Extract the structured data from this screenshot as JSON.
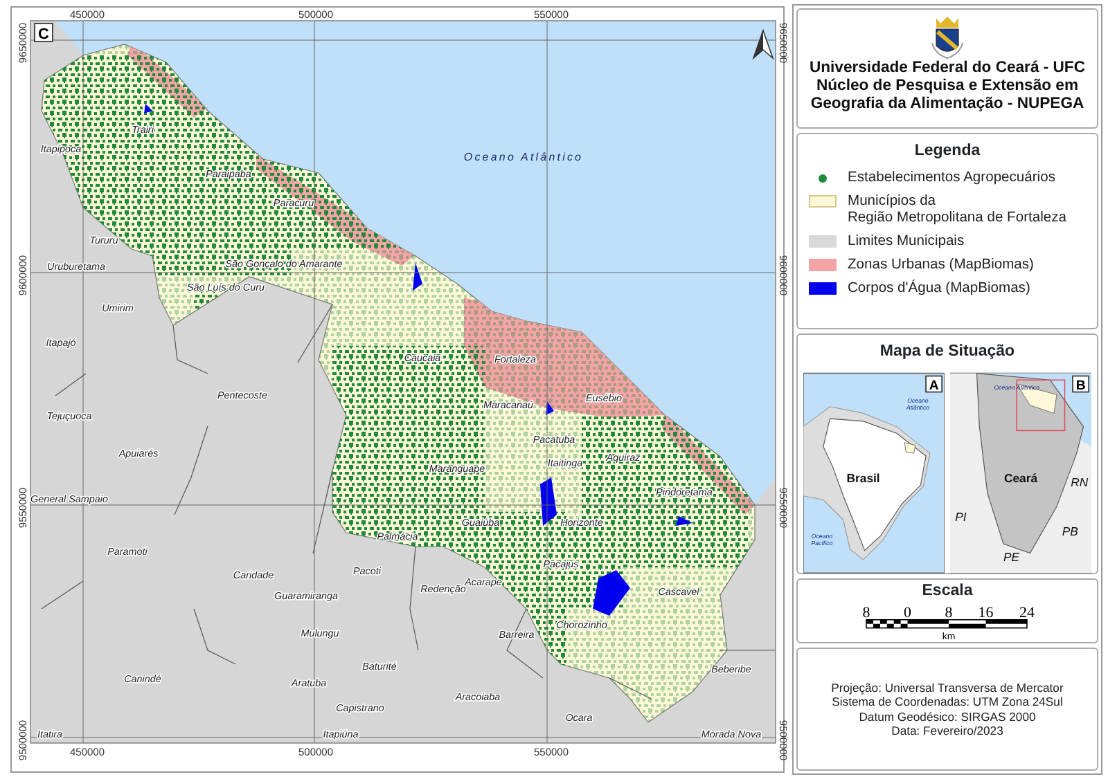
{
  "map": {
    "panel_letter": "C",
    "top_ticks": [
      "450000",
      "500000",
      "550000"
    ],
    "bottom_ticks": [
      "450000",
      "500000",
      "550000"
    ],
    "left_ticks": [
      "9650000",
      "9600000",
      "9550000",
      "9500000"
    ],
    "right_ticks": [
      "9650000",
      "9600000",
      "9550000",
      "9500000"
    ],
    "labels": [
      {
        "kind": "municipality",
        "text": "Trairi"
      },
      {
        "kind": "municipality",
        "text": "Itapipoca"
      },
      {
        "kind": "ocean",
        "text": "Oceano Atlântico"
      },
      {
        "kind": "municipality",
        "text": "Paraipaba"
      },
      {
        "kind": "municipality",
        "text": "Paracuru"
      },
      {
        "kind": "municipality",
        "text": "Tururu"
      },
      {
        "kind": "municipality",
        "text": "Uruburetama"
      },
      {
        "kind": "municipality",
        "text": "São Gonçalo do Amarante"
      },
      {
        "kind": "municipality",
        "text": "São Luís do Curu"
      },
      {
        "kind": "municipality",
        "text": "Umirim"
      },
      {
        "kind": "municipality",
        "text": "Itapajó"
      },
      {
        "kind": "municipality",
        "text": "Caucaia"
      },
      {
        "kind": "municipality",
        "text": "Fortaleza"
      },
      {
        "kind": "municipality",
        "text": "Pentecoste"
      },
      {
        "kind": "municipality",
        "text": "Maracanaú"
      },
      {
        "kind": "municipality",
        "text": "Eusébio"
      },
      {
        "kind": "municipality",
        "text": "Tejuçuoca"
      },
      {
        "kind": "municipality",
        "text": "Pacatuba"
      },
      {
        "kind": "municipality",
        "text": "Apuiarés"
      },
      {
        "kind": "municipality",
        "text": "Maranguape"
      },
      {
        "kind": "municipality",
        "text": "Itaitinga"
      },
      {
        "kind": "municipality",
        "text": "Aquiraz"
      },
      {
        "kind": "municipality",
        "text": "General Sampaio"
      },
      {
        "kind": "municipality",
        "text": "Pindoretama"
      },
      {
        "kind": "municipality",
        "text": "Guaiúba"
      },
      {
        "kind": "municipality",
        "text": "Horizonte"
      },
      {
        "kind": "municipality",
        "text": "Palmácia"
      },
      {
        "kind": "municipality",
        "text": "Paramoti"
      },
      {
        "kind": "municipality",
        "text": "Caridade"
      },
      {
        "kind": "municipality",
        "text": "Pacoti"
      },
      {
        "kind": "municipality",
        "text": "Pacajus"
      },
      {
        "kind": "municipality",
        "text": "Guaramiranga"
      },
      {
        "kind": "municipality",
        "text": "Redenção"
      },
      {
        "kind": "municipality",
        "text": "Acarape"
      },
      {
        "kind": "municipality",
        "text": "Cascavel"
      },
      {
        "kind": "municipality",
        "text": "Mulungu"
      },
      {
        "kind": "municipality",
        "text": "Barreira"
      },
      {
        "kind": "municipality",
        "text": "Chorozinho"
      },
      {
        "kind": "municipality",
        "text": "Baturité"
      },
      {
        "kind": "municipality",
        "text": "Beberibe"
      },
      {
        "kind": "municipality",
        "text": "Canindé"
      },
      {
        "kind": "municipality",
        "text": "Aratuba"
      },
      {
        "kind": "municipality",
        "text": "Aracoiaba"
      },
      {
        "kind": "municipality",
        "text": "Capistrano"
      },
      {
        "kind": "municipality",
        "text": "Ocara"
      },
      {
        "kind": "municipality",
        "text": "Itatira"
      },
      {
        "kind": "municipality",
        "text": "Itapiúna"
      },
      {
        "kind": "municipality",
        "text": "Morada Nova"
      }
    ]
  },
  "header": {
    "lines": [
      "Universidade Federal do Ceará - UFC",
      "Núcleo de Pesquisa e Extensão em",
      "Geografia da Alimentação - NUPEGA"
    ]
  },
  "legend": {
    "title": "Legenda",
    "items": [
      {
        "kind": "dot",
        "label": "Estabelecimentos Agropecuários",
        "color": "#1e8a3a"
      },
      {
        "kind": "fill",
        "label": "Municípios da\nRegião Metropolitana de Fortaleza",
        "color": "#fdf9d8"
      },
      {
        "kind": "fill",
        "label": "Limites Municipais",
        "color": "#d9d9d9"
      },
      {
        "kind": "fill",
        "label": "Zonas Urbanas (MapBiomas)",
        "color": "#f4a3a6"
      },
      {
        "kind": "fill",
        "label": "Corpos d'Água (MapBiomas)",
        "color": "#0000ee"
      }
    ]
  },
  "situation": {
    "title": "Mapa de Situação",
    "insets": [
      {
        "kind": "brazil",
        "letter": "A",
        "labels": [
          {
            "kind": "ocean",
            "text": "Oceano\nAtlântico"
          },
          {
            "kind": "country",
            "text": "Brasil"
          },
          {
            "kind": "ocean",
            "text": "Oceano\nPacífico"
          }
        ]
      },
      {
        "kind": "state",
        "letter": "B",
        "labels": [
          {
            "kind": "ocean",
            "text": "Oceano Atlântico"
          },
          {
            "kind": "country",
            "text": "Ceará"
          },
          {
            "kind": "neighbor",
            "text": "RN"
          },
          {
            "kind": "neighbor",
            "text": "PI"
          },
          {
            "kind": "neighbor",
            "text": "PB"
          },
          {
            "kind": "neighbor",
            "text": "PE"
          }
        ]
      }
    ]
  },
  "scale": {
    "title": "Escala",
    "ticks": [
      "8",
      "0",
      "8",
      "16",
      "24"
    ],
    "unit": "km"
  },
  "projection": {
    "lines": [
      "Projeção: Universal Transversa de Mercator",
      "Sistema de Coordenadas: UTM Zona 24Sul",
      "Datum Geodésico: SIRGAS 2000",
      "Data: Fevereiro/2023"
    ]
  }
}
